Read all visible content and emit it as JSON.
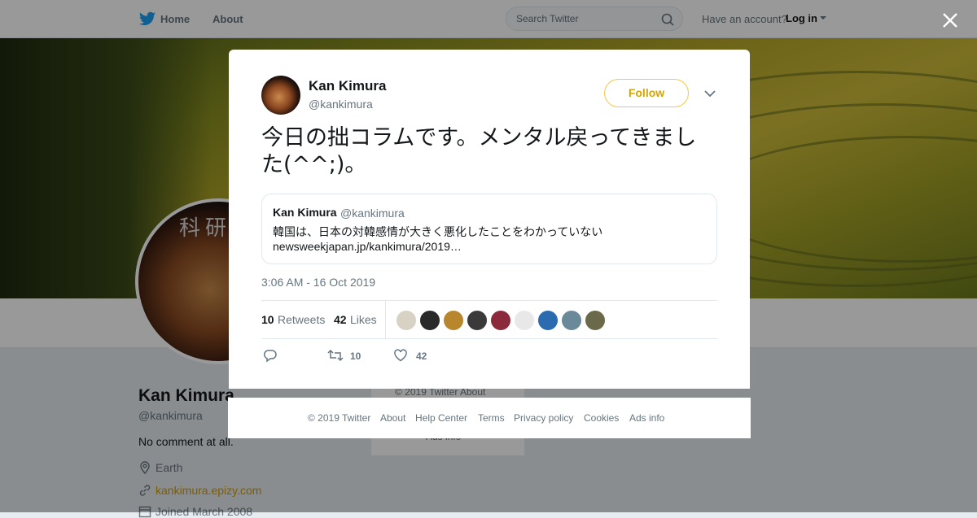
{
  "nav": {
    "home": "Home",
    "about": "About",
    "search_placeholder": "Search Twitter",
    "have_account": "Have an account?",
    "login": "Log in"
  },
  "profile": {
    "name": "Kan Kimura",
    "handle": "@kankimura",
    "bio": "No comment at all.",
    "location": "Earth",
    "website": "kankimura.epizy.com",
    "joined": "Joined March 2008",
    "avatar_text": "科研"
  },
  "side_card": {
    "line1": "© 2019 Twitter   About",
    "line2": "Ads info"
  },
  "tweet": {
    "author_name": "Kan Kimura",
    "author_handle": "@kankimura",
    "follow_label": "Follow",
    "text": "今日の拙コラムです。メンタル戻ってきました(^^;)。",
    "quote": {
      "name": "Kan Kimura",
      "handle": "@kankimura",
      "text": "韓国は、日本の対韓感情が大きく悪化したことをわかっていない",
      "link": "newsweekjapan.jp/kankimura/2019…"
    },
    "timestamp": "3:06 AM - 16 Oct 2019",
    "retweets_count": "10",
    "retweets_label": "Retweets",
    "likes_count": "42",
    "likes_label": "Likes",
    "reply_icon": "reply-icon",
    "retweet_action_count": "10",
    "like_action_count": "42"
  },
  "likers_colors": [
    "#d8d2c4",
    "#2a2a2a",
    "#b8862c",
    "#3a3a3a",
    "#8a2a3a",
    "#e8e8e8",
    "#2b6cb0",
    "#6a8a9a",
    "#6a6a4a"
  ],
  "footer": {
    "copyright": "© 2019 Twitter",
    "about": "About",
    "help": "Help Center",
    "terms": "Terms",
    "privacy": "Privacy policy",
    "cookies": "Cookies",
    "ads": "Ads info"
  },
  "colors": {
    "accent": "#1da1f2",
    "follow": "#d4a400",
    "link": "#d09a00"
  }
}
